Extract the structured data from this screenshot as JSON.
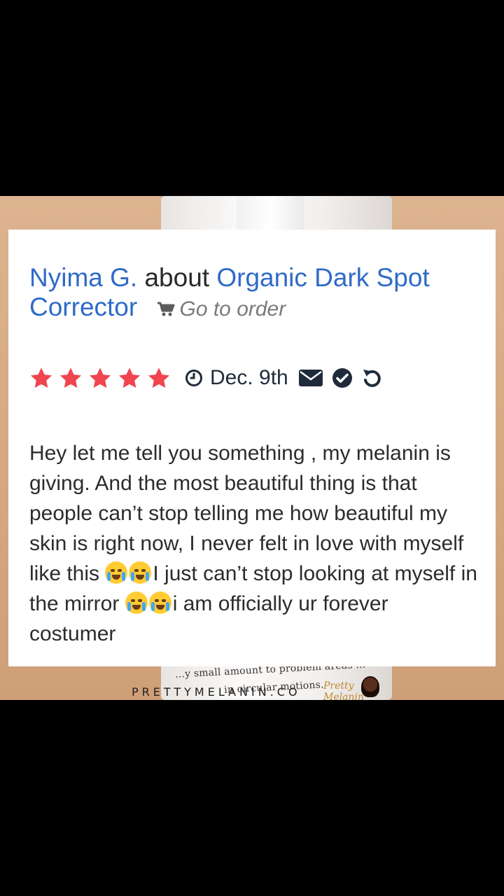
{
  "review": {
    "author": "Nyima G.",
    "about_word": "about",
    "product": "Organic Dark Spot Corrector",
    "go_to_order": "Go to order",
    "rating": 5,
    "max_rating": 5,
    "date": "Dec. 9th",
    "text": {
      "part1": "Hey let me tell you something , my melanin is giving. And the most beautiful thing is that people can’t stop telling me how beautiful my skin is right now, I never felt in love with myself like this ",
      "part2": "I just can’t stop looking at myself in the mirror ",
      "part3": "i am officially ur forever costumer"
    },
    "emojis": [
      "crying-face-emoji",
      "crying-face-emoji",
      "tears-of-joy-emoji",
      "tears-of-joy-emoji"
    ]
  },
  "background": {
    "bottle_text_line1": "...y small amount to problem areas ...",
    "bottle_text_line2": "in circular motions.",
    "watermark": "PRETTYMELANIN.CO",
    "logo_text": "Pretty Melanin"
  },
  "colors": {
    "link": "#2f6bc7",
    "star": "#f0454f",
    "meta_icon": "#1f2b3a",
    "card_bg": "#ffffff",
    "backdrop": "#d7ab84"
  },
  "icons": [
    "cart-icon",
    "star-icon",
    "clock-icon",
    "envelope-icon",
    "check-circle-icon",
    "undo-icon"
  ]
}
